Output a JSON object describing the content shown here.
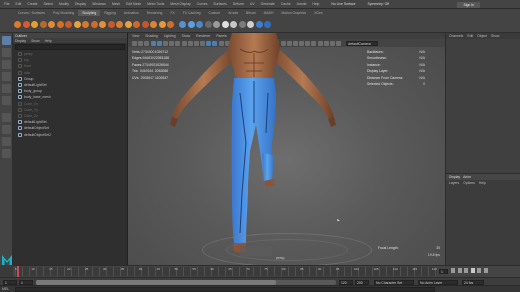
{
  "menubar": {
    "items": [
      "File",
      "Edit",
      "Create",
      "Select",
      "Modify",
      "Display",
      "Windows",
      "Mesh",
      "Edit Mesh",
      "Mesh Tools",
      "Mesh Display",
      "Curves",
      "Surfaces",
      "Deform",
      "UV",
      "Generate",
      "Cache",
      "Arnold",
      "Help"
    ],
    "workspace": "No Live Surface",
    "symmetry": "Symmetry: Off",
    "signin": "Sign In"
  },
  "shelf": {
    "tabs": [
      "Curves / Surfaces",
      "Poly Modeling",
      "Sculpting",
      "Rigging",
      "Animation",
      "Rendering",
      "FX",
      "FX Caching",
      "Custom",
      "Arnold",
      "Bifrost",
      "MASH",
      "Motion Graphics",
      "XGen"
    ],
    "active_tab": "Sculpting",
    "icon_colors": [
      "#e07a2a",
      "#d65a2f",
      "#e0a030",
      "#b86a2a",
      "#e08a34",
      "#d46f28",
      "#c95d2a",
      "#e8a13c",
      "#d8782e",
      "#cf6a30",
      "#e39038",
      "#c85a28",
      "#da7e30",
      "#e5a33e",
      "#d2672c",
      "#c75526",
      "#db8534",
      "#e6993a",
      "#cf6c2e",
      "#5a8fd0",
      "#5aa0e0",
      "#4d87c6",
      "#6a6a6a",
      "#9a9a9a",
      "#e0e0e0",
      "#c7c7c7",
      "#7b7b7b",
      "#d0d0d0",
      "#3d7fd0",
      "#2f6fc0"
    ]
  },
  "outliner": {
    "title": "Outliner",
    "menu": [
      "Display",
      "Show",
      "Help"
    ],
    "items": [
      {
        "label": "persp",
        "dim": true
      },
      {
        "label": "top",
        "dim": true
      },
      {
        "label": "front",
        "dim": true
      },
      {
        "label": "side",
        "dim": true
      },
      {
        "label": "Group",
        "dim": false
      },
      {
        "label": "defaultLightSet",
        "dim": false
      },
      {
        "label": "body_group",
        "dim": false
      },
      {
        "label": "body_base_mesh",
        "dim": false
      },
      {
        "label": "Cube_Xx",
        "dim": true
      },
      {
        "label": "Cube_Yy",
        "dim": true
      },
      {
        "label": "Cube_Zz",
        "dim": true
      },
      {
        "label": "defaultLightSet",
        "dim": false
      },
      {
        "label": "defaultObjectSet",
        "dim": false
      },
      {
        "label": "defaultObjectSet2",
        "dim": false
      }
    ]
  },
  "viewport": {
    "menu": [
      "View",
      "Shading",
      "Lighting",
      "Show",
      "Renderer",
      "Panels"
    ],
    "camera_field": "defaultCamera",
    "hud_left": [
      {
        "label": "Verts:",
        "v1": "2734300",
        "v2": "1026712"
      },
      {
        "label": "Edges:",
        "v1": "5468302",
        "v2": "2053188"
      },
      {
        "label": "Faces:",
        "v1": "2734592",
        "v2": "1026544"
      },
      {
        "label": "Tris:",
        "v1": "5469184",
        "v2": "2053088"
      },
      {
        "label": "UVs:",
        "v1": "2908847",
        "v2": "1100837"
      }
    ],
    "hud_right": [
      {
        "label": "Backfaces:",
        "value": "N/A"
      },
      {
        "label": "Smoothness:",
        "value": "N/A"
      },
      {
        "label": "Instance:",
        "value": "N/A"
      },
      {
        "label": "Display Layer:",
        "value": "N/A"
      },
      {
        "label": "Distance From Camera:",
        "value": "N/A"
      },
      {
        "label": "Selected Objects:",
        "value": "0"
      }
    ],
    "focal_label": "Focal Length:",
    "focal_value": "35",
    "fps": "19.8 fps",
    "camera_label": "persp"
  },
  "channelbox": {
    "tabs": [
      "Channels",
      "Edit",
      "Object",
      "Show"
    ]
  },
  "layers": {
    "tabs": [
      "Display",
      "Anim"
    ],
    "menu": [
      "Layers",
      "Options",
      "Help"
    ]
  },
  "timeline": {
    "ticks": [
      "5",
      "10",
      "15",
      "20",
      "25",
      "30",
      "35",
      "40",
      "45",
      "50",
      "55",
      "60",
      "65",
      "70",
      "75",
      "80",
      "85",
      "90",
      "95",
      "100",
      "105",
      "110",
      "115",
      "120"
    ],
    "current_frame": "1",
    "end_frame": "120"
  },
  "rangebar": {
    "start": "1",
    "range_start": "1",
    "range_end": "120",
    "end": "200",
    "character_set": "No Character Set",
    "anim_layer": "No Anim Layer",
    "fps": "24 fps"
  },
  "cmdline": {
    "label": "MEL"
  }
}
